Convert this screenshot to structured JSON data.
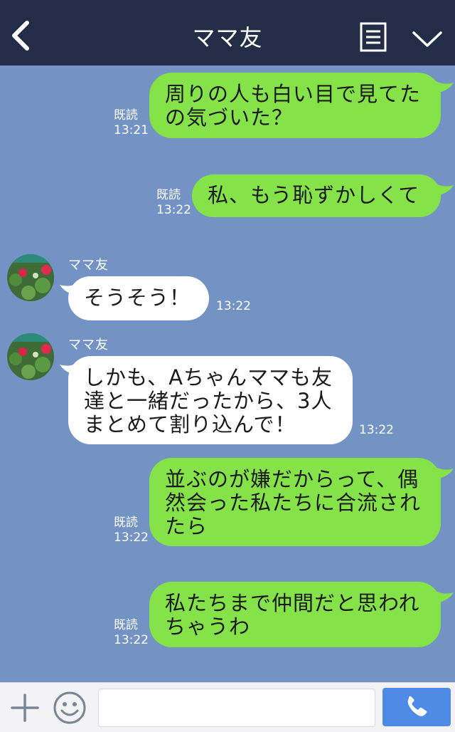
{
  "header": {
    "title": "ママ友"
  },
  "contact": {
    "name": "ママ友"
  },
  "messages": [
    {
      "dir": "out",
      "text": "周りの人も白い目で見てた\nの気づいた？",
      "read": "既読",
      "time": "13:21"
    },
    {
      "dir": "out",
      "text": "私、もう恥ずかしくて",
      "read": "既読",
      "time": "13:22"
    },
    {
      "dir": "in",
      "sender": "ママ友",
      "text": "そうそう！",
      "time": "13:22"
    },
    {
      "dir": "in",
      "sender": "ママ友",
      "text": "しかも、Aちゃんママも友\n達と一緒だったから、3人\nまとめて割り込んで！",
      "time": "13:22"
    },
    {
      "dir": "out",
      "text": "並ぶのが嫌だからって、偶\n然会った私たちに合流され\nたら",
      "read": "既読",
      "time": "13:22"
    },
    {
      "dir": "out",
      "text": "私たちまで仲間だと思われ\nちゃうわ",
      "read": "既読",
      "time": "13:22"
    }
  ],
  "input": {
    "placeholder": ""
  },
  "colors": {
    "header": "#232d47",
    "background": "#7293c3",
    "outgoing": "#85e249",
    "incoming": "#ffffff",
    "call": "#4f8be6"
  },
  "icons": {
    "back": "chevron-left-icon",
    "notes": "notes-icon",
    "menu": "chevron-down-icon",
    "plus": "plus-icon",
    "emoji": "smile-icon",
    "call": "phone-icon"
  }
}
